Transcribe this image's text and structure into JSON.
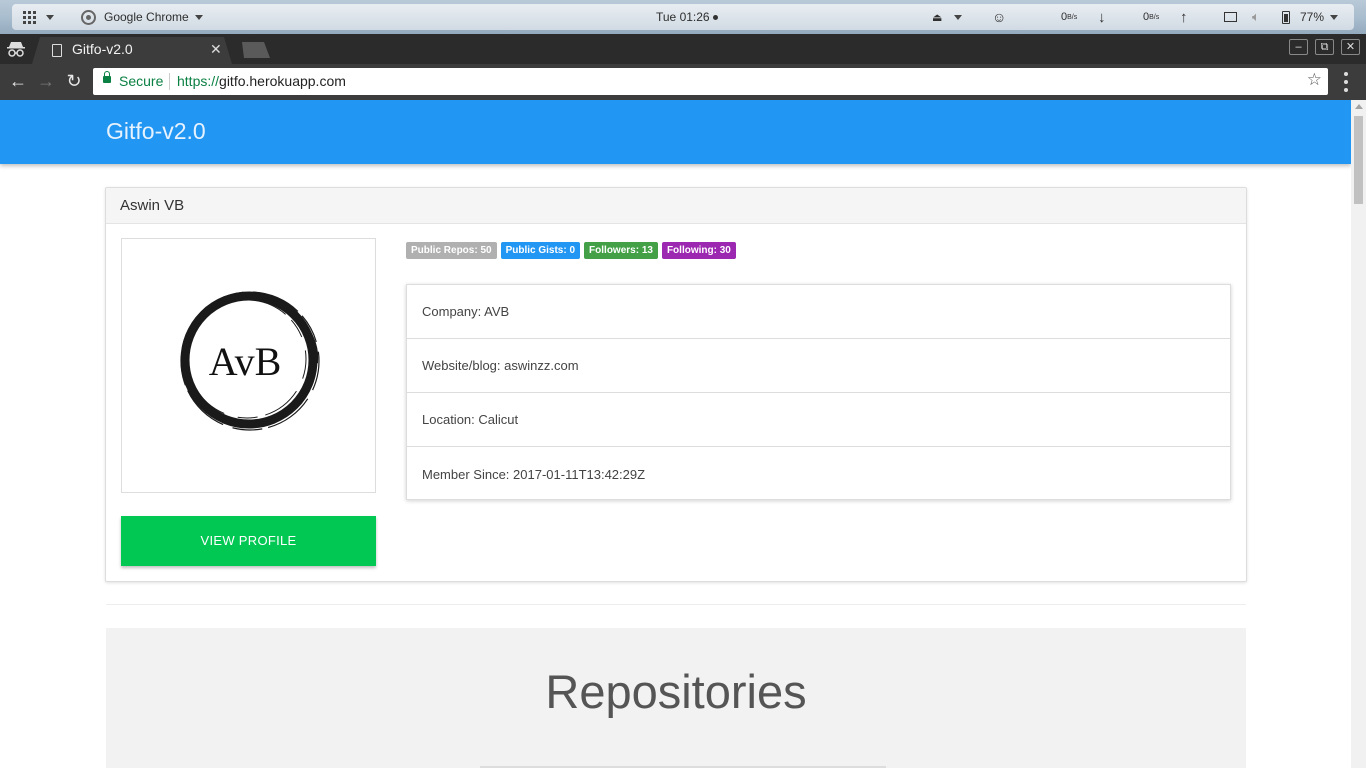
{
  "os_bar": {
    "app_name": "Google Chrome",
    "clock": "Tue 01:26",
    "net_down_value": "0",
    "net_down_unit": "B/s",
    "net_up_value": "0",
    "net_up_unit": "B/s",
    "battery": "77%",
    "icons": [
      "apps-grid-icon",
      "chrome-logo-icon",
      "eject-icon",
      "smiley-icon",
      "download-arrow-icon",
      "upload-arrow-icon",
      "display-icon",
      "volume-icon",
      "battery-icon"
    ]
  },
  "browser": {
    "tab_title": "Gitfo-v2.0",
    "security_label": "Secure",
    "url_scheme": "https://",
    "url_host": "gitfo.herokuapp.com"
  },
  "navbar": {
    "brand": "Gitfo-v2.0",
    "color": "#2196f3"
  },
  "profile": {
    "name": "Aswin VB",
    "avatar_text": "AvB",
    "badges": [
      {
        "label": "Public Repos: 50",
        "color": "#b0b0b0"
      },
      {
        "label": "Public Gists: 0",
        "color": "#2196f3"
      },
      {
        "label": "Followers: 13",
        "color": "#43a047"
      },
      {
        "label": "Following: 30",
        "color": "#9c27b0"
      }
    ],
    "details": [
      "Company: AVB",
      "Website/blog: aswinzz.com",
      "Location: Calicut",
      "Member Since: 2017-01-11T13:42:29Z"
    ],
    "view_button": "VIEW PROFILE",
    "view_button_color": "#00c853"
  },
  "repositories": {
    "title": "Repositories"
  }
}
